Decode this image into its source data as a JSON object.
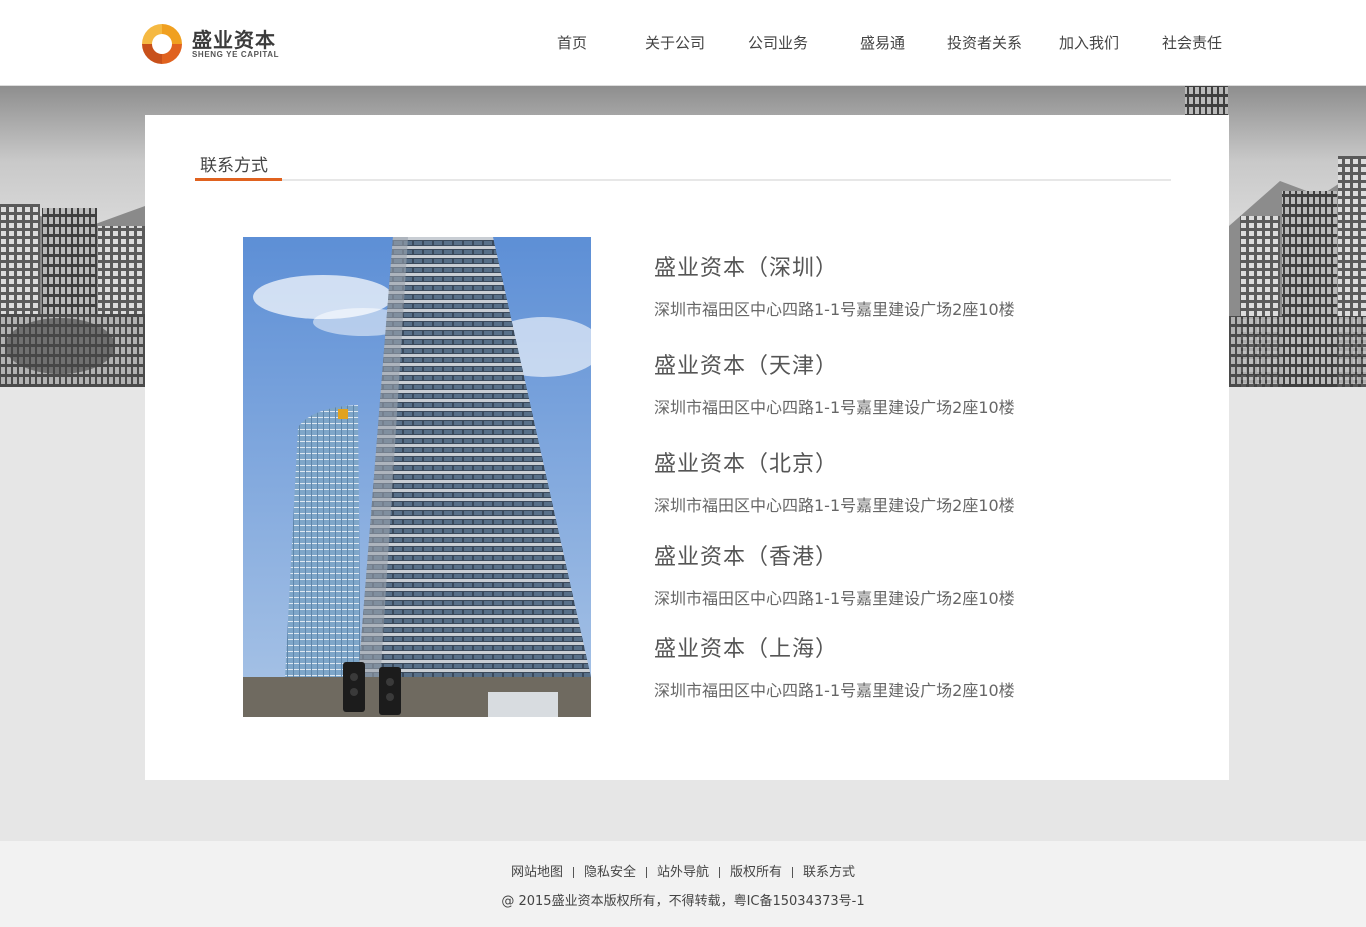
{
  "brand": {
    "name": "盛业资本",
    "subtitle": "SHENG YE CAPITAL",
    "accent": "#e0621f"
  },
  "nav": [
    {
      "label": "首页"
    },
    {
      "label": "关于公司"
    },
    {
      "label": "公司业务"
    },
    {
      "label": "盛易通"
    },
    {
      "label": "投资者关系"
    },
    {
      "label": "加入我们"
    },
    {
      "label": "社会责任"
    }
  ],
  "section": {
    "title": "联系方式"
  },
  "offices": [
    {
      "name": "盛业资本（深圳）",
      "address": "深圳市福田区中心四路1-1号嘉里建设广场2座10楼"
    },
    {
      "name": "盛业资本（天津）",
      "address": "深圳市福田区中心四路1-1号嘉里建设广场2座10楼"
    },
    {
      "name": "盛业资本（北京）",
      "address": "深圳市福田区中心四路1-1号嘉里建设广场2座10楼"
    },
    {
      "name": "盛业资本（香港）",
      "address": "深圳市福田区中心四路1-1号嘉里建设广场2座10楼"
    },
    {
      "name": "盛业资本（上海）",
      "address": "深圳市福田区中心四路1-1号嘉里建设广场2座10楼"
    }
  ],
  "footer": {
    "links": [
      {
        "label": "网站地图"
      },
      {
        "label": "隐私安全"
      },
      {
        "label": "站外导航"
      },
      {
        "label": "版权所有"
      },
      {
        "label": "联系方式"
      }
    ],
    "copyright": "@ 2015盛业资本版权所有，不得转载，粤IC备15034373号-1"
  }
}
